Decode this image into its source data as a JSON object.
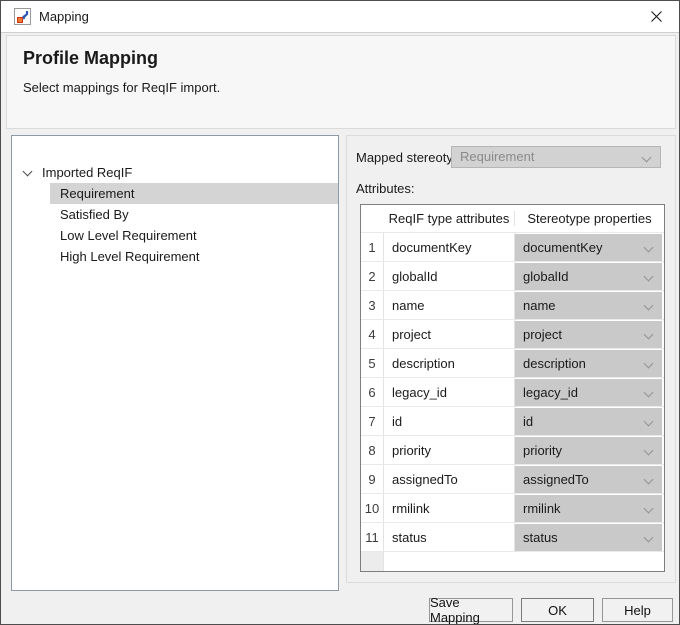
{
  "window": {
    "title": "Mapping"
  },
  "header": {
    "title": "Profile Mapping",
    "subtitle": "Select mappings for ReqIF import."
  },
  "tree": {
    "root_label": "Imported ReqIF",
    "items": [
      {
        "label": "Requirement",
        "selected": true
      },
      {
        "label": "Satisfied By",
        "selected": false
      },
      {
        "label": "Low Level Requirement",
        "selected": false
      },
      {
        "label": "High Level Requirement",
        "selected": false
      }
    ]
  },
  "mapped_stereotype": {
    "label": "Mapped stereotype:",
    "value": "Requirement",
    "disabled": true
  },
  "attributes": {
    "label": "Attributes:",
    "columns": [
      "ReqIF type attributes",
      "Stereotype properties"
    ],
    "rows": [
      {
        "num": "1",
        "attribute": "documentKey",
        "property": "documentKey"
      },
      {
        "num": "2",
        "attribute": "globalId",
        "property": "globalId"
      },
      {
        "num": "3",
        "attribute": "name",
        "property": "name"
      },
      {
        "num": "4",
        "attribute": "project",
        "property": "project"
      },
      {
        "num": "5",
        "attribute": "description",
        "property": "description"
      },
      {
        "num": "6",
        "attribute": "legacy_id",
        "property": "legacy_id"
      },
      {
        "num": "7",
        "attribute": "id",
        "property": "id"
      },
      {
        "num": "8",
        "attribute": "priority",
        "property": "priority"
      },
      {
        "num": "9",
        "attribute": "assignedTo",
        "property": "assignedTo"
      },
      {
        "num": "10",
        "attribute": "rmilink",
        "property": "rmilink"
      },
      {
        "num": "11",
        "attribute": "status",
        "property": "status"
      }
    ]
  },
  "buttons": {
    "save": "Save Mapping",
    "ok": "OK",
    "help": "Help"
  },
  "colors": {
    "dialog_bg": "#f0f0f0",
    "tree_selection_bg": "#d4d4d4",
    "disabled_dropdown_bg": "#d2d2d2",
    "property_dropdown_bg": "#c9c9c9",
    "table_border": "#7e7e7e"
  }
}
